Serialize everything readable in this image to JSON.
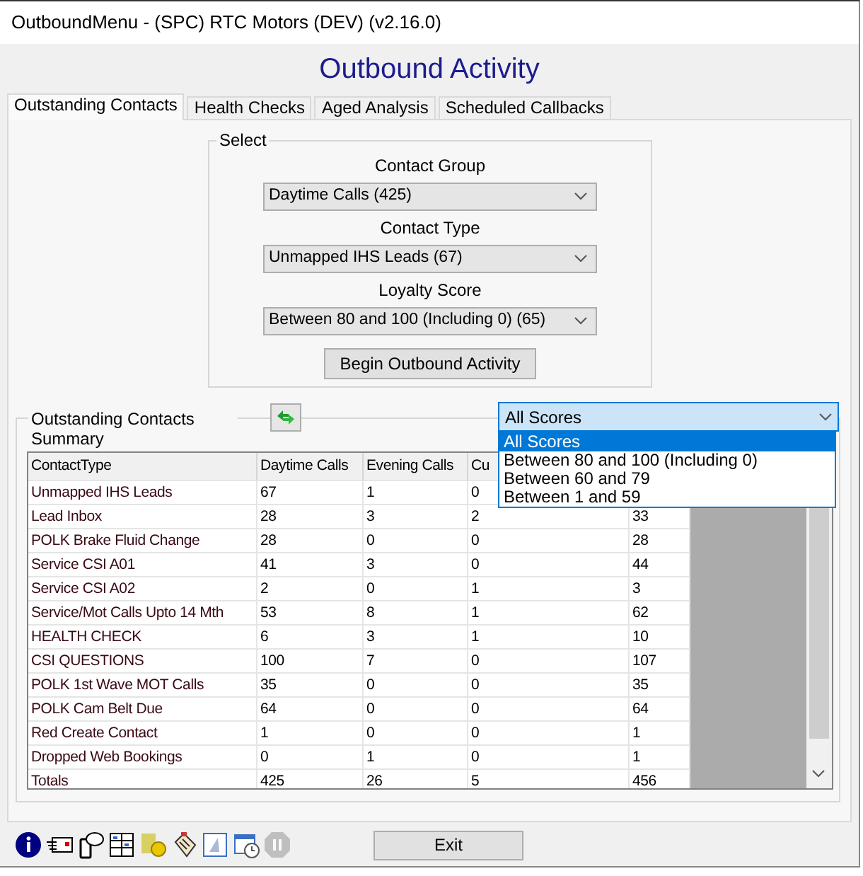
{
  "window": {
    "title": "OutboundMenu - (SPC) RTC Motors (DEV) (v2.16.0)"
  },
  "heading": "Outbound Activity",
  "tabs": [
    {
      "label": "Outstanding Contacts",
      "selected": true
    },
    {
      "label": "Health Checks",
      "selected": false
    },
    {
      "label": "Aged Analysis",
      "selected": false
    },
    {
      "label": "Scheduled Callbacks",
      "selected": false
    }
  ],
  "select_group": {
    "title": "Select",
    "fields": [
      {
        "label": "Contact Group",
        "value": "Daytime Calls (425)"
      },
      {
        "label": "Contact Type",
        "value": "Unmapped IHS Leads (67)"
      },
      {
        "label": "Loyalty Score",
        "value": "Between 80 and 100 (Including 0) (65)"
      }
    ],
    "button": "Begin Outbound Activity"
  },
  "summary": {
    "title": "Outstanding Contacts Summary",
    "score_filter": {
      "value": "All Scores",
      "expanded": true,
      "options": [
        {
          "label": "All Scores",
          "selected": true
        },
        {
          "label": "Between 80 and 100 (Including 0)",
          "selected": false
        },
        {
          "label": "Between 60 and 79",
          "selected": false
        },
        {
          "label": "Between 1 and 59",
          "selected": false
        }
      ]
    },
    "table": {
      "columns": [
        "ContactType",
        "Daytime Calls",
        "Evening Calls",
        "Cu"
      ],
      "rows": [
        [
          "Unmapped IHS Leads",
          "67",
          "1",
          "0"
        ],
        [
          "Lead Inbox",
          "28",
          "3",
          "2",
          "33"
        ],
        [
          "POLK Brake Fluid Change",
          "28",
          "0",
          "0",
          "28"
        ],
        [
          "Service CSI A01",
          "41",
          "3",
          "0",
          "44"
        ],
        [
          "Service CSI A02",
          "2",
          "0",
          "1",
          "3"
        ],
        [
          "Service/Mot Calls Upto 14 Mth",
          "53",
          "8",
          "1",
          "62"
        ],
        [
          "HEALTH CHECK",
          "6",
          "3",
          "1",
          "10"
        ],
        [
          "CSI QUESTIONS",
          "100",
          "7",
          "0",
          "107"
        ],
        [
          "POLK 1st Wave MOT Calls",
          "35",
          "0",
          "0",
          "35"
        ],
        [
          "POLK Cam Belt Due",
          "64",
          "0",
          "0",
          "64"
        ],
        [
          "Red Create Contact",
          "1",
          "0",
          "0",
          "1"
        ],
        [
          "Dropped Web Bookings",
          "0",
          "1",
          "0",
          "1"
        ],
        [
          "Totals",
          "425",
          "26",
          "5",
          "456"
        ]
      ]
    }
  },
  "toolbar_icons": [
    {
      "kind": "info",
      "disabled": false
    },
    {
      "kind": "card",
      "disabled": false
    },
    {
      "kind": "phone",
      "disabled": false
    },
    {
      "kind": "grid",
      "disabled": false
    },
    {
      "kind": "coins",
      "disabled": false
    },
    {
      "kind": "clipboard",
      "disabled": false
    },
    {
      "kind": "document",
      "disabled": false
    },
    {
      "kind": "calendar",
      "disabled": false
    },
    {
      "kind": "pause",
      "disabled": true
    }
  ],
  "exit_button": "Exit"
}
